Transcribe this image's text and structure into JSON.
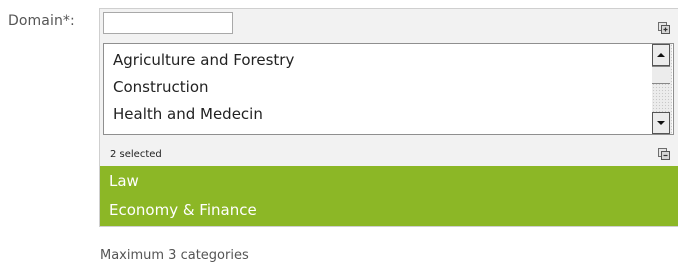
{
  "domain_field": {
    "label": "Domain*:",
    "search_value": "",
    "options": [
      "Agriculture and Forestry",
      "Construction",
      "Health and Medecin"
    ],
    "selected_count_text": "2 selected",
    "selected": [
      "Law",
      "Economy & Finance"
    ],
    "hint": "Maximum 3 categories"
  },
  "colors": {
    "selected_background": "#8cb726",
    "selected_text": "#ffffff",
    "panel_background": "#f2f2f2"
  },
  "icons": {
    "add_all": "add-all-icon",
    "remove_all": "remove-all-icon",
    "scroll_up": "arrow-up-icon",
    "scroll_down": "arrow-down-icon"
  }
}
